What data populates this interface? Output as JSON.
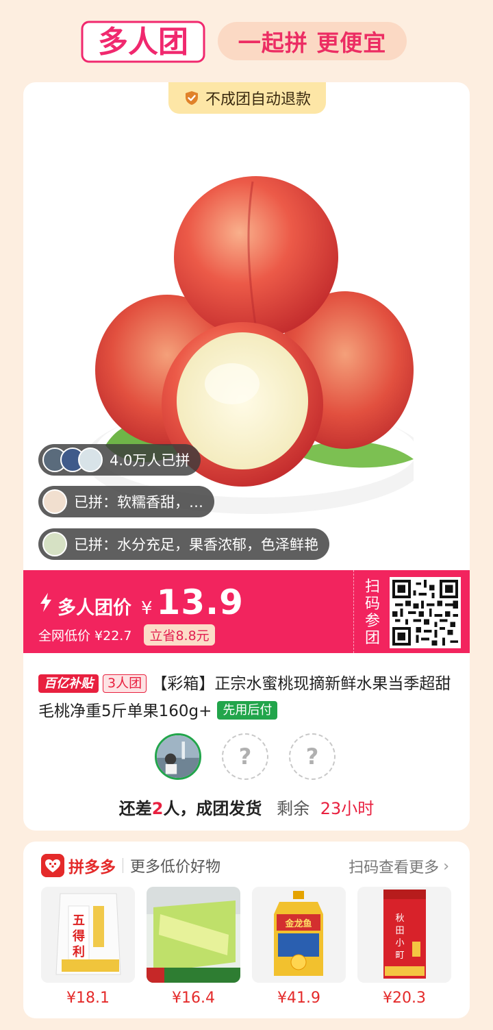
{
  "header": {
    "logo_text": "多人团",
    "slogan": "一起拼 更便宜"
  },
  "refund_badge": "不成团自动退款",
  "social": {
    "joined_count": "4.0万人已拼",
    "review_1": "已拼：软糯香甜，…",
    "review_2": "已拼：水分充足，果香浓郁，色泽鲜艳"
  },
  "price": {
    "label": "多人团价",
    "currency": "¥",
    "value": "13.9",
    "compare_text": "全网低价 ¥22.7",
    "save_text": "立省8.8元",
    "qr_label": "扫码参团"
  },
  "product": {
    "tag_subsidy": "百亿补贴",
    "tag_group": "3人团",
    "title": "【彩箱】正宗水蜜桃现摘新鲜水果当季超甜毛桃净重5斤单果160g+",
    "tag_pay_later": "先用后付"
  },
  "group_status": {
    "need_prefix": "还差",
    "need_count": "2",
    "need_suffix": "人，成团发货",
    "remain_label": "剩余",
    "remain_time": "23小时",
    "empty_slot": "?"
  },
  "more": {
    "brand": "拼多多",
    "subtitle": "更多低价好物",
    "scan_more": "扫码查看更多",
    "items": [
      {
        "price": "¥18.1",
        "icon": "flour-bag"
      },
      {
        "price": "¥16.4",
        "icon": "tissue-pack"
      },
      {
        "price": "¥41.9",
        "icon": "oil-bottle"
      },
      {
        "price": "¥20.3",
        "icon": "rice-bag"
      }
    ]
  },
  "colors": {
    "accent": "#f2245e",
    "brand_red": "#e42a2a",
    "background": "#fdeee0",
    "green": "#22a54b"
  }
}
